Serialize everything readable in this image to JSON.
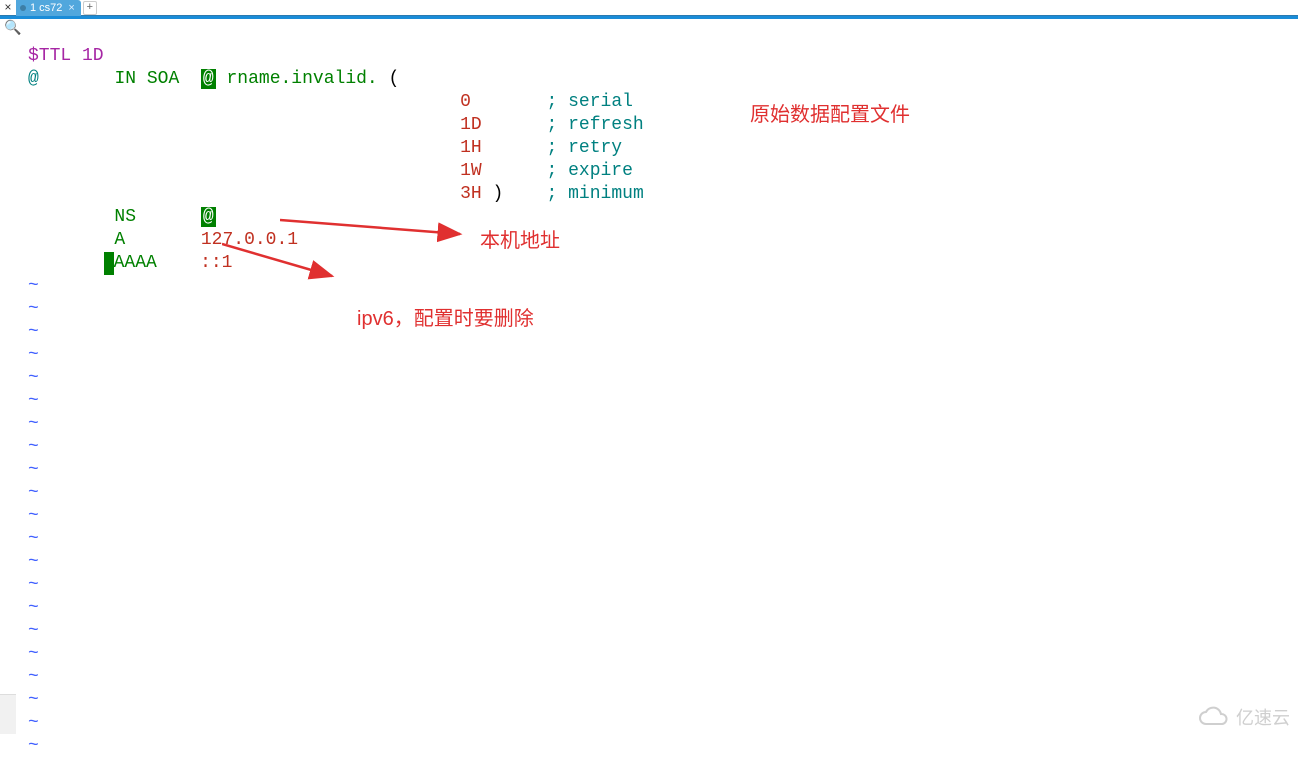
{
  "tab": {
    "title": "1 cs72",
    "close_glyph": "×",
    "plus_glyph": "+",
    "x_glyph": "×"
  },
  "gutter": {
    "zoom_glyph": "🔍"
  },
  "code": {
    "l1_ttl": "$TTL 1D",
    "l2_at": "@",
    "l2_in": "IN",
    "l2_soa": "SOA",
    "l2_at2": "@",
    "l2_rname": "rname.invalid.",
    "l2_paren": "(",
    "l3_v": "0",
    "l3_c": "; serial",
    "l4_v": "1D",
    "l4_c": "; refresh",
    "l5_v": "1H",
    "l5_c": "; retry",
    "l6_v": "1W",
    "l6_c": "; expire",
    "l7_v": "3H",
    "l7_p": ")",
    "l7_c": "; minimum",
    "l8_ns": "NS",
    "l8_at": "@",
    "l9_a": "A",
    "l9_ip": "127.0.0.1",
    "l10_aaaa": "AAAA",
    "l10_ip": "::1"
  },
  "tilde": "~",
  "annot": {
    "a1": "原始数据配置文件",
    "a2": "本机地址",
    "a3": "ipv6，配置时要删除"
  },
  "watermark": "亿速云"
}
